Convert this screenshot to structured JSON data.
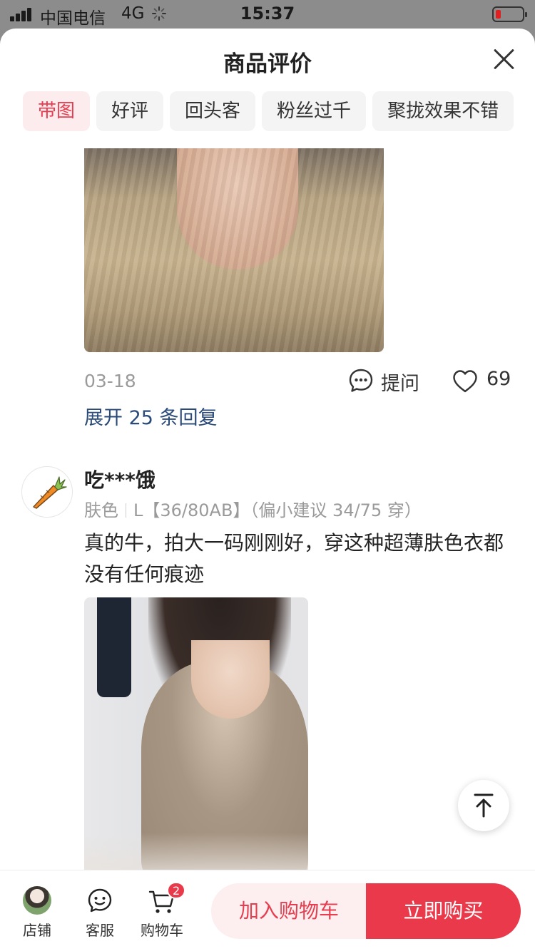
{
  "status_bar": {
    "carrier": "中国电信",
    "network": "4G",
    "time": "15:37"
  },
  "sheet": {
    "title": "商品评价"
  },
  "filters": [
    {
      "label": "带图",
      "active": true
    },
    {
      "label": "好评",
      "active": false
    },
    {
      "label": "回头客",
      "active": false
    },
    {
      "label": "粉丝过千",
      "active": false
    },
    {
      "label": "聚拢效果不错",
      "active": false
    }
  ],
  "review1": {
    "date": "03-18",
    "ask_label": "提问",
    "likes": "69",
    "replies_link": "展开 25 条回复"
  },
  "review2": {
    "username": "吃***饿",
    "spec_color": "肤色",
    "spec_size": "L【36/80AB】（偏小建议 34/75 穿）",
    "text": "真的牛，拍大一码刚刚好，穿这种超薄肤色衣都没有任何痕迹"
  },
  "bottom_bar": {
    "shop_label": "店铺",
    "service_label": "客服",
    "cart_label": "购物车",
    "cart_badge": "2",
    "add_to_cart": "加入购物车",
    "buy_now": "立即购买"
  },
  "colors": {
    "accent": "#e9394a",
    "chip_active_bg": "#fdecee",
    "link": "#2a4a7a"
  }
}
